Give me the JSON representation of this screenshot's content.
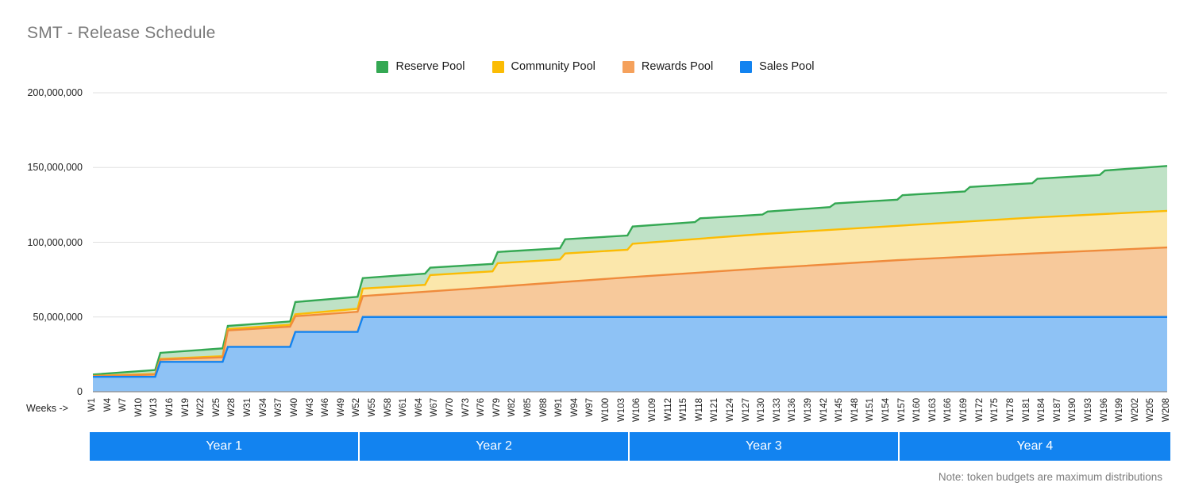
{
  "header": {
    "title": "SMT - Release Schedule"
  },
  "legend": {
    "position": "top-center",
    "items": [
      {
        "label": "Reserve Pool",
        "color": "#34a853",
        "icon": "square-swatch"
      },
      {
        "label": "Community Pool",
        "color": "#fbbc04",
        "icon": "square-swatch"
      },
      {
        "label": "Rewards Pool",
        "color": "#f5a15c",
        "icon": "square-swatch"
      },
      {
        "label": "Sales Pool",
        "color": "#1283f0",
        "icon": "square-swatch"
      }
    ]
  },
  "axis": {
    "x_axis_caption": "Weeks ->",
    "y_ticks": [
      "200,000,000",
      "150,000,000",
      "100,000,000",
      "50,000,000",
      "0"
    ]
  },
  "year_bands": [
    {
      "label": "Year 1",
      "start_week": 1,
      "end_week": 52
    },
    {
      "label": "Year 2",
      "start_week": 53,
      "end_week": 104
    },
    {
      "label": "Year 3",
      "start_week": 105,
      "end_week": 156
    },
    {
      "label": "Year 4",
      "start_week": 157,
      "end_week": 208
    }
  ],
  "footer": {
    "note": "Note: token budgets are maximum distributions"
  },
  "chart_data": {
    "type": "area",
    "stacked": true,
    "title": "SMT - Release Schedule",
    "xlabel": "Weeks ->",
    "ylabel": "",
    "ylim": [
      0,
      200000000
    ],
    "ytick_values": [
      0,
      50000000,
      100000000,
      150000000,
      200000000
    ],
    "grid": true,
    "x_unit": "week",
    "x_tick_step": 3,
    "x_tick_labels": [
      "W1",
      "W4",
      "W7",
      "W10",
      "W13",
      "W16",
      "W19",
      "W22",
      "W25",
      "W28",
      "W31",
      "W34",
      "W37",
      "W40",
      "W43",
      "W46",
      "W49",
      "W52",
      "W55",
      "W58",
      "W61",
      "W64",
      "W67",
      "W70",
      "W73",
      "W76",
      "W79",
      "W82",
      "W85",
      "W88",
      "W91",
      "W94",
      "W97",
      "W100",
      "W103",
      "W106",
      "W109",
      "W112",
      "W115",
      "W118",
      "W121",
      "W124",
      "W127",
      "W130",
      "W133",
      "W136",
      "W139",
      "W142",
      "W145",
      "W148",
      "W151",
      "W154",
      "W157",
      "W160",
      "W163",
      "W166",
      "W169",
      "W172",
      "W175",
      "W178",
      "W181",
      "W184",
      "W187",
      "W190",
      "W193",
      "W196",
      "W199",
      "W202",
      "W205",
      "W208"
    ],
    "x_range": [
      1,
      208
    ],
    "legend_position": "top-center",
    "series": [
      {
        "name": "Sales Pool",
        "color": "#1283f0",
        "fill": "#8ec2f5",
        "shape": "step",
        "description": "Quarterly step increases of 10,000,000 during Year 1, then flat at 50,000,000.",
        "points": [
          {
            "week": 1,
            "value": 10000000
          },
          {
            "week": 13,
            "value": 10000000
          },
          {
            "week": 14,
            "value": 20000000
          },
          {
            "week": 26,
            "value": 20000000
          },
          {
            "week": 27,
            "value": 30000000
          },
          {
            "week": 39,
            "value": 30000000
          },
          {
            "week": 40,
            "value": 40000000
          },
          {
            "week": 52,
            "value": 40000000
          },
          {
            "week": 53,
            "value": 50000000
          },
          {
            "week": 208,
            "value": 50000000
          }
        ]
      },
      {
        "name": "Rewards Pool",
        "color": "#ef8b3c",
        "fill": "#f7c99b",
        "shape": "linear-with-steps",
        "description": "Cumulative total of Sales + Rewards. Rises steadily, reaching about 96,000,000 by W208.",
        "points_cumulative": [
          {
            "week": 1,
            "value": 10400000
          },
          {
            "week": 13,
            "value": 11500000
          },
          {
            "week": 14,
            "value": 21500000
          },
          {
            "week": 26,
            "value": 23000000
          },
          {
            "week": 27,
            "value": 41000000
          },
          {
            "week": 39,
            "value": 43500000
          },
          {
            "week": 40,
            "value": 50500000
          },
          {
            "week": 52,
            "value": 53500000
          },
          {
            "week": 53,
            "value": 64000000
          },
          {
            "week": 78,
            "value": 70000000
          },
          {
            "week": 104,
            "value": 76500000
          },
          {
            "week": 130,
            "value": 82500000
          },
          {
            "week": 156,
            "value": 88000000
          },
          {
            "week": 182,
            "value": 92500000
          },
          {
            "week": 208,
            "value": 96500000
          }
        ]
      },
      {
        "name": "Community Pool",
        "color": "#fbbc04",
        "fill": "#fbe7ab",
        "shape": "linear-with-steps",
        "description": "Cumulative total of Sales + Rewards + Community. Visible only from about W55 onward, reaching about 121,000,000 by W208.",
        "points_cumulative": [
          {
            "week": 1,
            "value": 10600000
          },
          {
            "week": 13,
            "value": 11900000
          },
          {
            "week": 14,
            "value": 21900000
          },
          {
            "week": 26,
            "value": 23800000
          },
          {
            "week": 27,
            "value": 42000000
          },
          {
            "week": 39,
            "value": 44800000
          },
          {
            "week": 40,
            "value": 51800000
          },
          {
            "week": 52,
            "value": 55500000
          },
          {
            "week": 53,
            "value": 69000000
          },
          {
            "week": 65,
            "value": 71500000
          },
          {
            "week": 66,
            "value": 78000000
          },
          {
            "week": 78,
            "value": 80500000
          },
          {
            "week": 79,
            "value": 86000000
          },
          {
            "week": 91,
            "value": 88500000
          },
          {
            "week": 92,
            "value": 92500000
          },
          {
            "week": 104,
            "value": 95000000
          },
          {
            "week": 105,
            "value": 99000000
          },
          {
            "week": 130,
            "value": 105500000
          },
          {
            "week": 156,
            "value": 111000000
          },
          {
            "week": 182,
            "value": 116500000
          },
          {
            "week": 208,
            "value": 121000000
          }
        ]
      },
      {
        "name": "Reserve Pool",
        "color": "#34a853",
        "fill": "#bfe2c6",
        "shape": "step",
        "description": "Grand total of all pools. Quarterly stepped increases throughout, reaching about 151,000,000 by W208.",
        "points_cumulative": [
          {
            "week": 1,
            "value": 11500000
          },
          {
            "week": 13,
            "value": 14500000
          },
          {
            "week": 14,
            "value": 26000000
          },
          {
            "week": 26,
            "value": 29000000
          },
          {
            "week": 27,
            "value": 44000000
          },
          {
            "week": 39,
            "value": 47000000
          },
          {
            "week": 40,
            "value": 60000000
          },
          {
            "week": 52,
            "value": 63500000
          },
          {
            "week": 53,
            "value": 76000000
          },
          {
            "week": 65,
            "value": 79000000
          },
          {
            "week": 66,
            "value": 83000000
          },
          {
            "week": 78,
            "value": 85500000
          },
          {
            "week": 79,
            "value": 93500000
          },
          {
            "week": 91,
            "value": 96000000
          },
          {
            "week": 92,
            "value": 102000000
          },
          {
            "week": 104,
            "value": 104500000
          },
          {
            "week": 105,
            "value": 110500000
          },
          {
            "week": 117,
            "value": 113500000
          },
          {
            "week": 118,
            "value": 116000000
          },
          {
            "week": 130,
            "value": 118500000
          },
          {
            "week": 131,
            "value": 120500000
          },
          {
            "week": 143,
            "value": 123500000
          },
          {
            "week": 144,
            "value": 126000000
          },
          {
            "week": 156,
            "value": 128500000
          },
          {
            "week": 157,
            "value": 131500000
          },
          {
            "week": 169,
            "value": 134000000
          },
          {
            "week": 170,
            "value": 137000000
          },
          {
            "week": 182,
            "value": 139500000
          },
          {
            "week": 183,
            "value": 142500000
          },
          {
            "week": 195,
            "value": 145000000
          },
          {
            "week": 196,
            "value": 148000000
          },
          {
            "week": 208,
            "value": 151000000
          }
        ]
      }
    ]
  }
}
